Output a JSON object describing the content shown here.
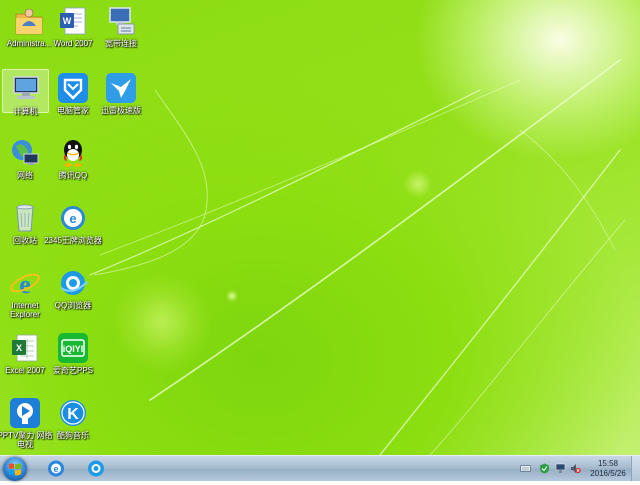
{
  "desktop": {
    "icons": [
      {
        "label": "Administra...",
        "icon": "user-folder-icon"
      },
      {
        "label": "Word 2007",
        "icon": "word-icon"
      },
      {
        "label": "宽带连接",
        "icon": "broadband-icon"
      },
      {
        "label": "计算机",
        "icon": "computer-icon"
      },
      {
        "label": "电脑管家",
        "icon": "pc-manager-icon"
      },
      {
        "label": "迅雷极速版",
        "icon": "thunder-icon"
      },
      {
        "label": "网络",
        "icon": "network-icon"
      },
      {
        "label": "腾讯QQ",
        "icon": "qq-icon"
      },
      {
        "label": "回收站",
        "icon": "recycle-bin-icon"
      },
      {
        "label": "2345王牌浏览器",
        "icon": "browser-2345-icon"
      },
      {
        "label": "Internet Explorer",
        "icon": "ie-icon"
      },
      {
        "label": "QQ浏览器",
        "icon": "qq-browser-icon"
      },
      {
        "label": "Excel 2007",
        "icon": "excel-icon"
      },
      {
        "label": "爱奇艺PPS",
        "icon": "iqiyi-icon"
      },
      {
        "label": "PPTV聚力 网络电视",
        "icon": "pptv-icon"
      },
      {
        "label": "酷狗音乐",
        "icon": "kugou-icon"
      }
    ]
  },
  "taskbar": {
    "start": "start-orb-icon",
    "pinned": [
      "ie-icon",
      "qq-browser-icon"
    ],
    "tray": [
      "keyboard-icon",
      "security-icon",
      "network-icon",
      "volume-muted-icon"
    ],
    "time": "15:58",
    "date": "2016/5/26"
  },
  "colors": {
    "accent": "#8cde10",
    "taskbar": "#a7bccf"
  }
}
